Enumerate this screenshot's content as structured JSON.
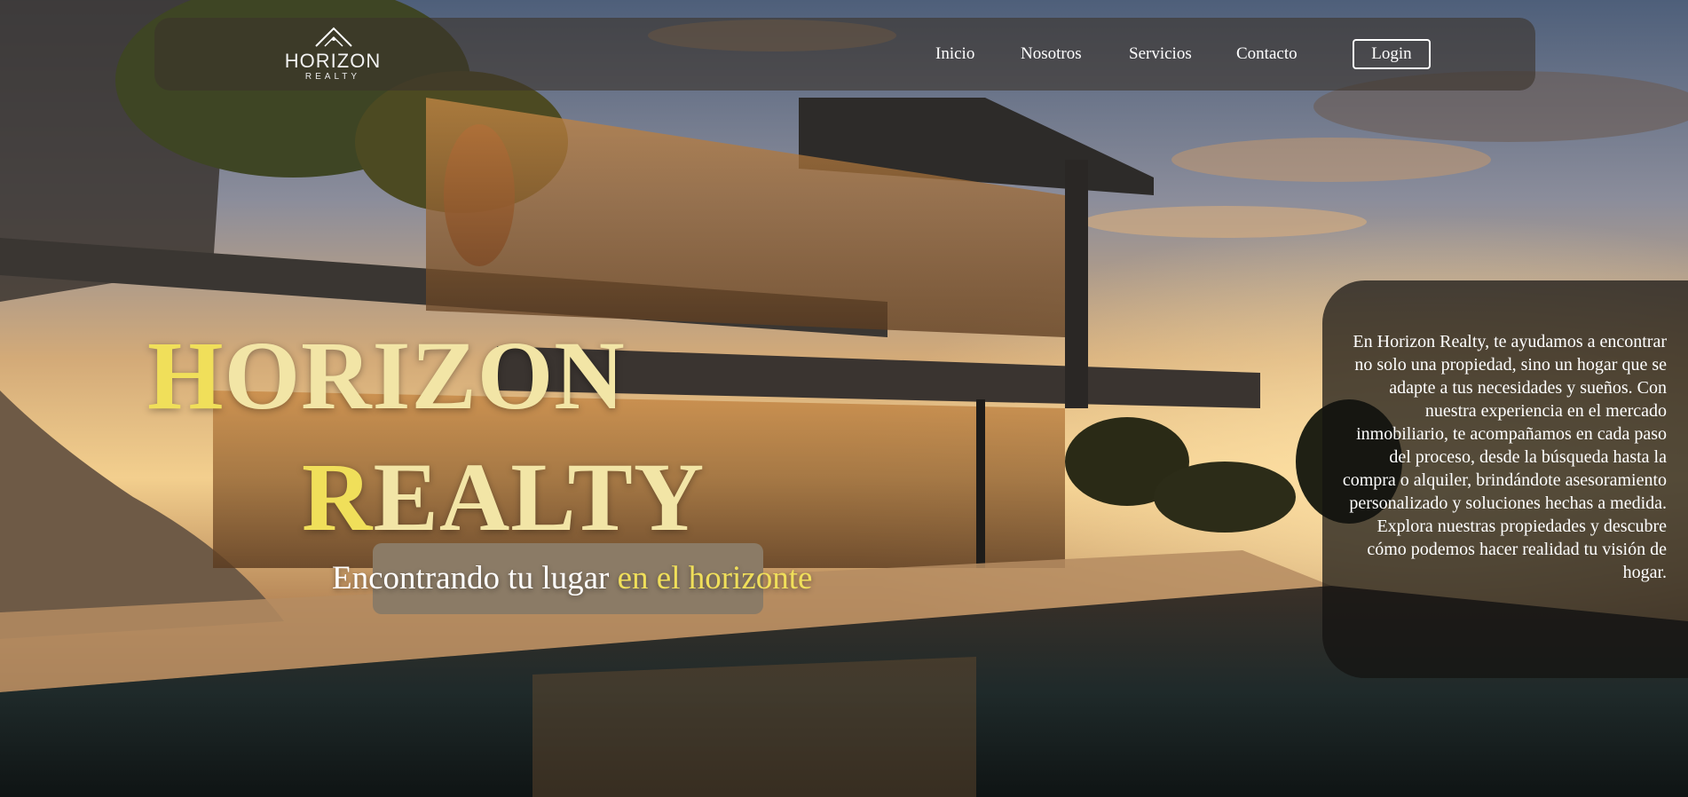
{
  "brand": {
    "logo_name": "HORIZON",
    "logo_sub": "REALTY"
  },
  "nav": {
    "items": [
      {
        "label": "Inicio"
      },
      {
        "label": "Nosotros"
      },
      {
        "label": "Servicios"
      },
      {
        "label": "Contacto"
      }
    ],
    "login_label": "Login"
  },
  "hero": {
    "title_line1_first": "H",
    "title_line1_rest": "ORIZON",
    "title_line2_first": "R",
    "title_line2_rest": "EALTY",
    "tagline_main": "Encontrando tu lugar ",
    "tagline_accent": "en el horizonte"
  },
  "info": {
    "text": "En Horizon Realty, te ayudamos a encontrar no solo una propiedad, sino un hogar que se adapte a tus necesidades y sueños. Con nuestra experiencia en el mercado inmobiliario, te acompañamos en cada paso del proceso, desde la búsqueda hasta la compra o alquiler, brindándote asesoramiento personalizado y soluciones hechas a medida. Explora nuestras propiedades y descubre cómo podemos hacer realidad tu visión de hogar."
  },
  "colors": {
    "accent_yellow": "#f0df5a",
    "title_cream": "#f2e5a6",
    "nav_bg": "rgba(60,52,44,0.62)",
    "panel_bg": "rgba(20,18,16,0.72)"
  },
  "icons": {
    "logo": "house-roof-icon"
  }
}
